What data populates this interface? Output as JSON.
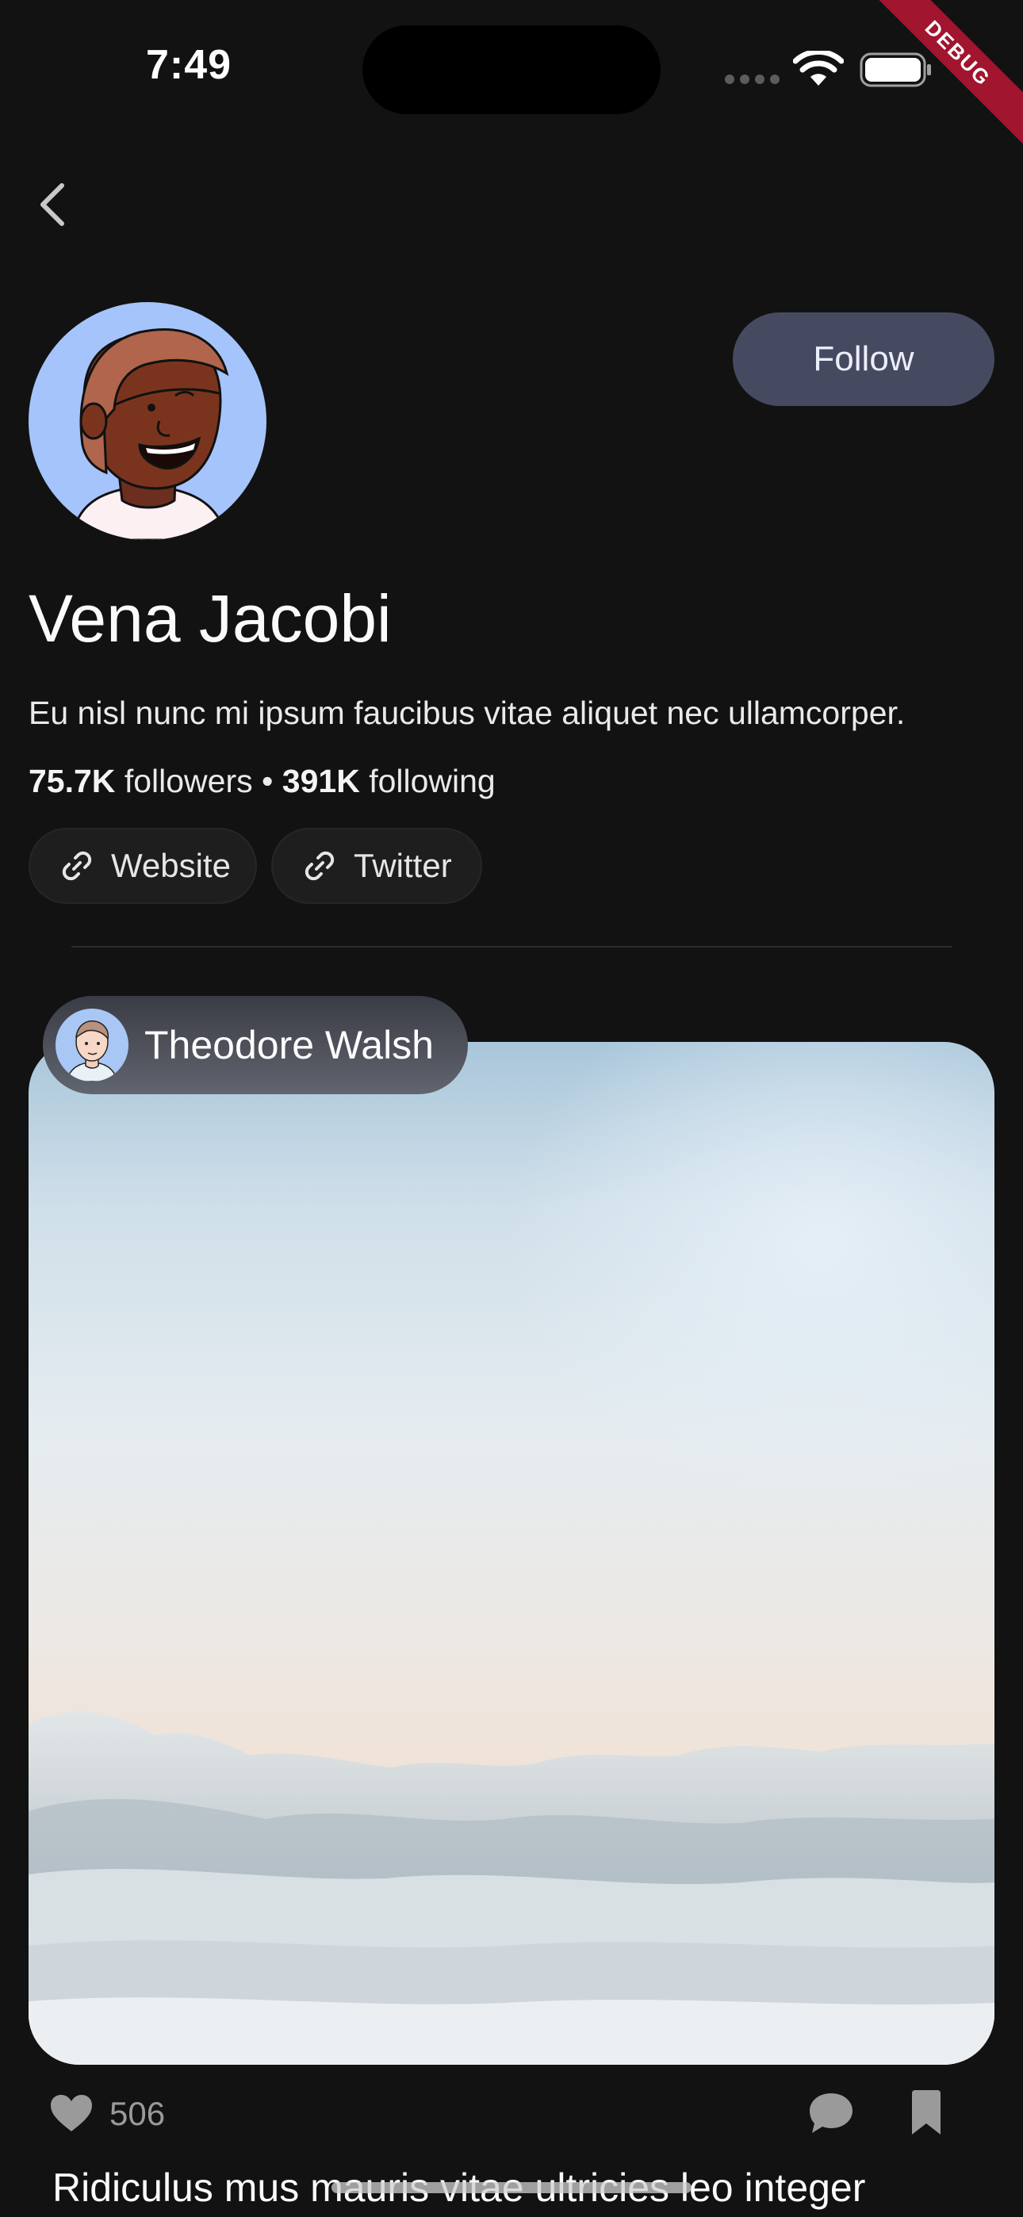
{
  "status_bar": {
    "time": "7:49"
  },
  "debug_banner": "DEBUG",
  "profile": {
    "name": "Vena Jacobi",
    "bio": "Eu nisl nunc mi ipsum faucibus vitae aliquet nec ullamcorper.",
    "followers_count": "75.7K",
    "followers_label": "followers",
    "separator": "•",
    "following_count": "391K",
    "following_label": "following",
    "follow_label": "Follow",
    "links": [
      {
        "label": "Website",
        "icon": "link-icon"
      },
      {
        "label": "Twitter",
        "icon": "link-icon"
      }
    ]
  },
  "post": {
    "author": "Theodore Walsh",
    "image": "sky-above-clouds",
    "likes": "506",
    "title": "Ridiculus mus mauris vitae ultricies leo integer"
  },
  "colors": {
    "background": "#121212",
    "follow_button": "#464a61",
    "avatar_bg": "#a5c4fb",
    "debug_ribbon": "#a1152f"
  }
}
